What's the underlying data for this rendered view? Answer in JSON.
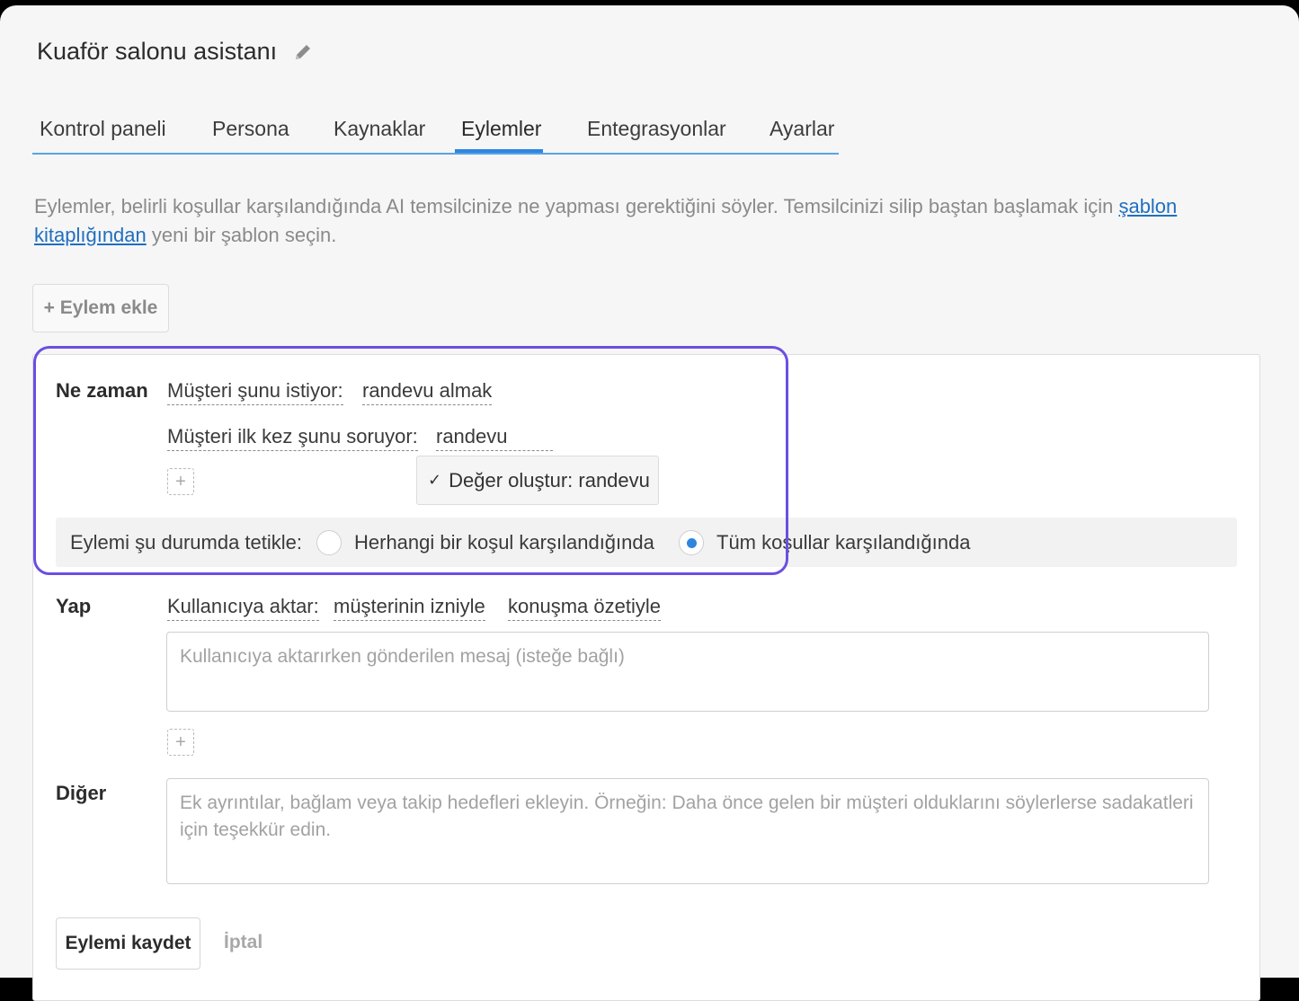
{
  "app": {
    "title": "Kuaför salonu asistanı"
  },
  "tabs": [
    {
      "label": "Kontrol paneli"
    },
    {
      "label": "Persona"
    },
    {
      "label": "Kaynaklar"
    },
    {
      "label": "Eylemler",
      "active": true
    },
    {
      "label": "Entegrasyonlar"
    },
    {
      "label": "Ayarlar"
    }
  ],
  "description": {
    "text_before": "Eylemler, belirli koşullar karşılandığında AI temsilcinize ne yapması gerektiğini söyler. Temsilcinizi silip baştan başlamak için ",
    "link": "şablon kitaplığından",
    "text_after": " yeni bir şablon seçin."
  },
  "add_action_label": "+ Eylem ekle",
  "when": {
    "label": "Ne zaman",
    "conditions": [
      {
        "field": "Müşteri şunu istiyor:",
        "value": "randevu almak"
      },
      {
        "field": "Müşteri ilk kez şunu soruyor:",
        "value": "randevu"
      }
    ],
    "dropdown_option": "Değer oluştur: randevu",
    "trigger": {
      "label": "Eylemi şu durumda tetikle:",
      "options": [
        {
          "label": "Herhangi bir koşul karşılandığında",
          "selected": false
        },
        {
          "label": "Tüm koşullar karşılandığında",
          "selected": true
        }
      ]
    }
  },
  "do": {
    "label": "Yap",
    "action": "Kullanıcıya aktar:",
    "option1": "müşterinin izniyle",
    "option2": "konuşma özetiyle",
    "message_placeholder": "Kullanıcıya aktarırken gönderilen mesaj (isteğe bağlı)"
  },
  "other": {
    "label": "Diğer",
    "placeholder": "Ek ayrıntılar, bağlam veya takip hedefleri ekleyin. Örneğin: Daha önce gelen bir müşteri olduklarını söylerlerse sadakatleri için teşekkür edin."
  },
  "buttons": {
    "save": "Eylemi kaydet",
    "cancel": "İptal"
  },
  "colors": {
    "accent": "#2e86de",
    "highlight": "#6b4fe0",
    "link": "#1f6fc0"
  }
}
